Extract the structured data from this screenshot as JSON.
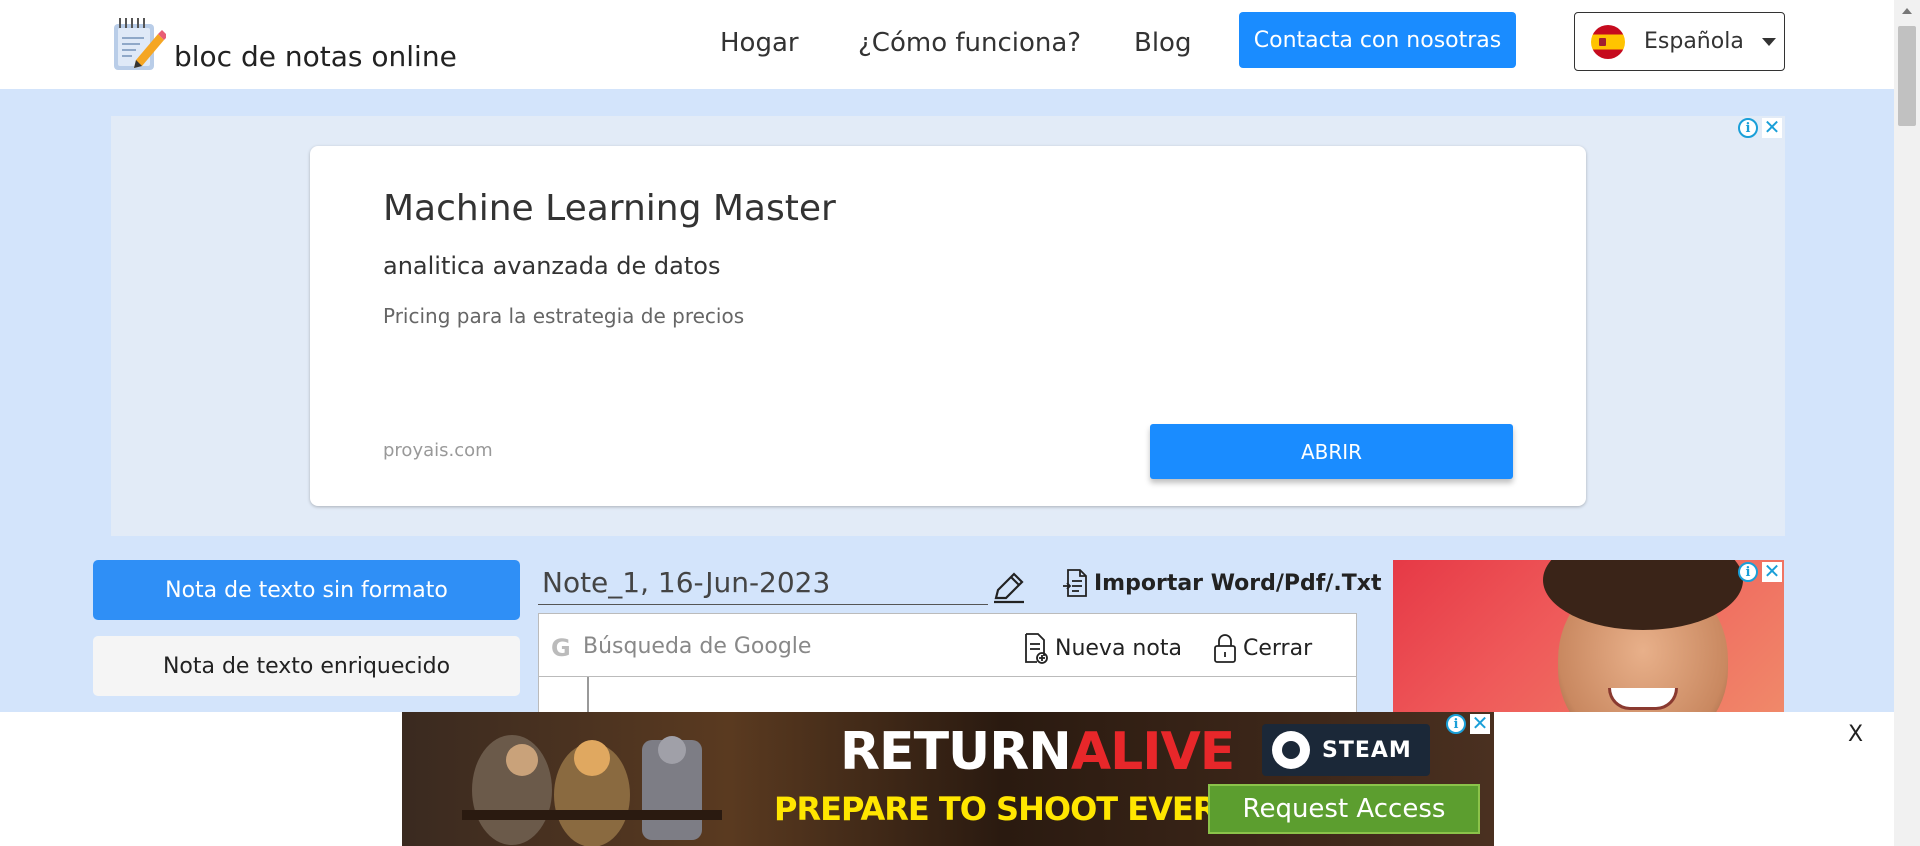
{
  "header": {
    "logo_text": "bloc de notas online",
    "nav": [
      {
        "label": "Hogar"
      },
      {
        "label": "¿Cómo funciona?"
      },
      {
        "label": "Blog"
      }
    ],
    "contact_label": "Contacta con nosotras",
    "language": "Española"
  },
  "top_ad": {
    "title": "Machine Learning Master",
    "subtitle": "analitica avanzada de datos",
    "description": "Pricing para la estrategia de precios",
    "domain": "proyais.com",
    "cta": "ABRIR"
  },
  "sidebar": {
    "plain_note": "Nota de texto sin formato",
    "rich_note": "Nota de texto enriquecido"
  },
  "editor": {
    "note_title": "Note_1, 16-Jun-2023",
    "import_label": "Importar Word/Pdf/.Txt",
    "search_placeholder": "Búsqueda de Google",
    "new_note": "Nueva nota",
    "close": "Cerrar"
  },
  "bottom_ad": {
    "headline_white": "RETURN",
    "headline_red": "ALIVE",
    "tagline": "PREPARE TO SHOOT EVERYTHING",
    "platform": "STEAM",
    "cta": "Request Access",
    "close_label": "X"
  },
  "colors": {
    "primary": "#1a8cff",
    "page_bg": "#d3e4fb",
    "ad_bg": "#e2ebf7"
  }
}
